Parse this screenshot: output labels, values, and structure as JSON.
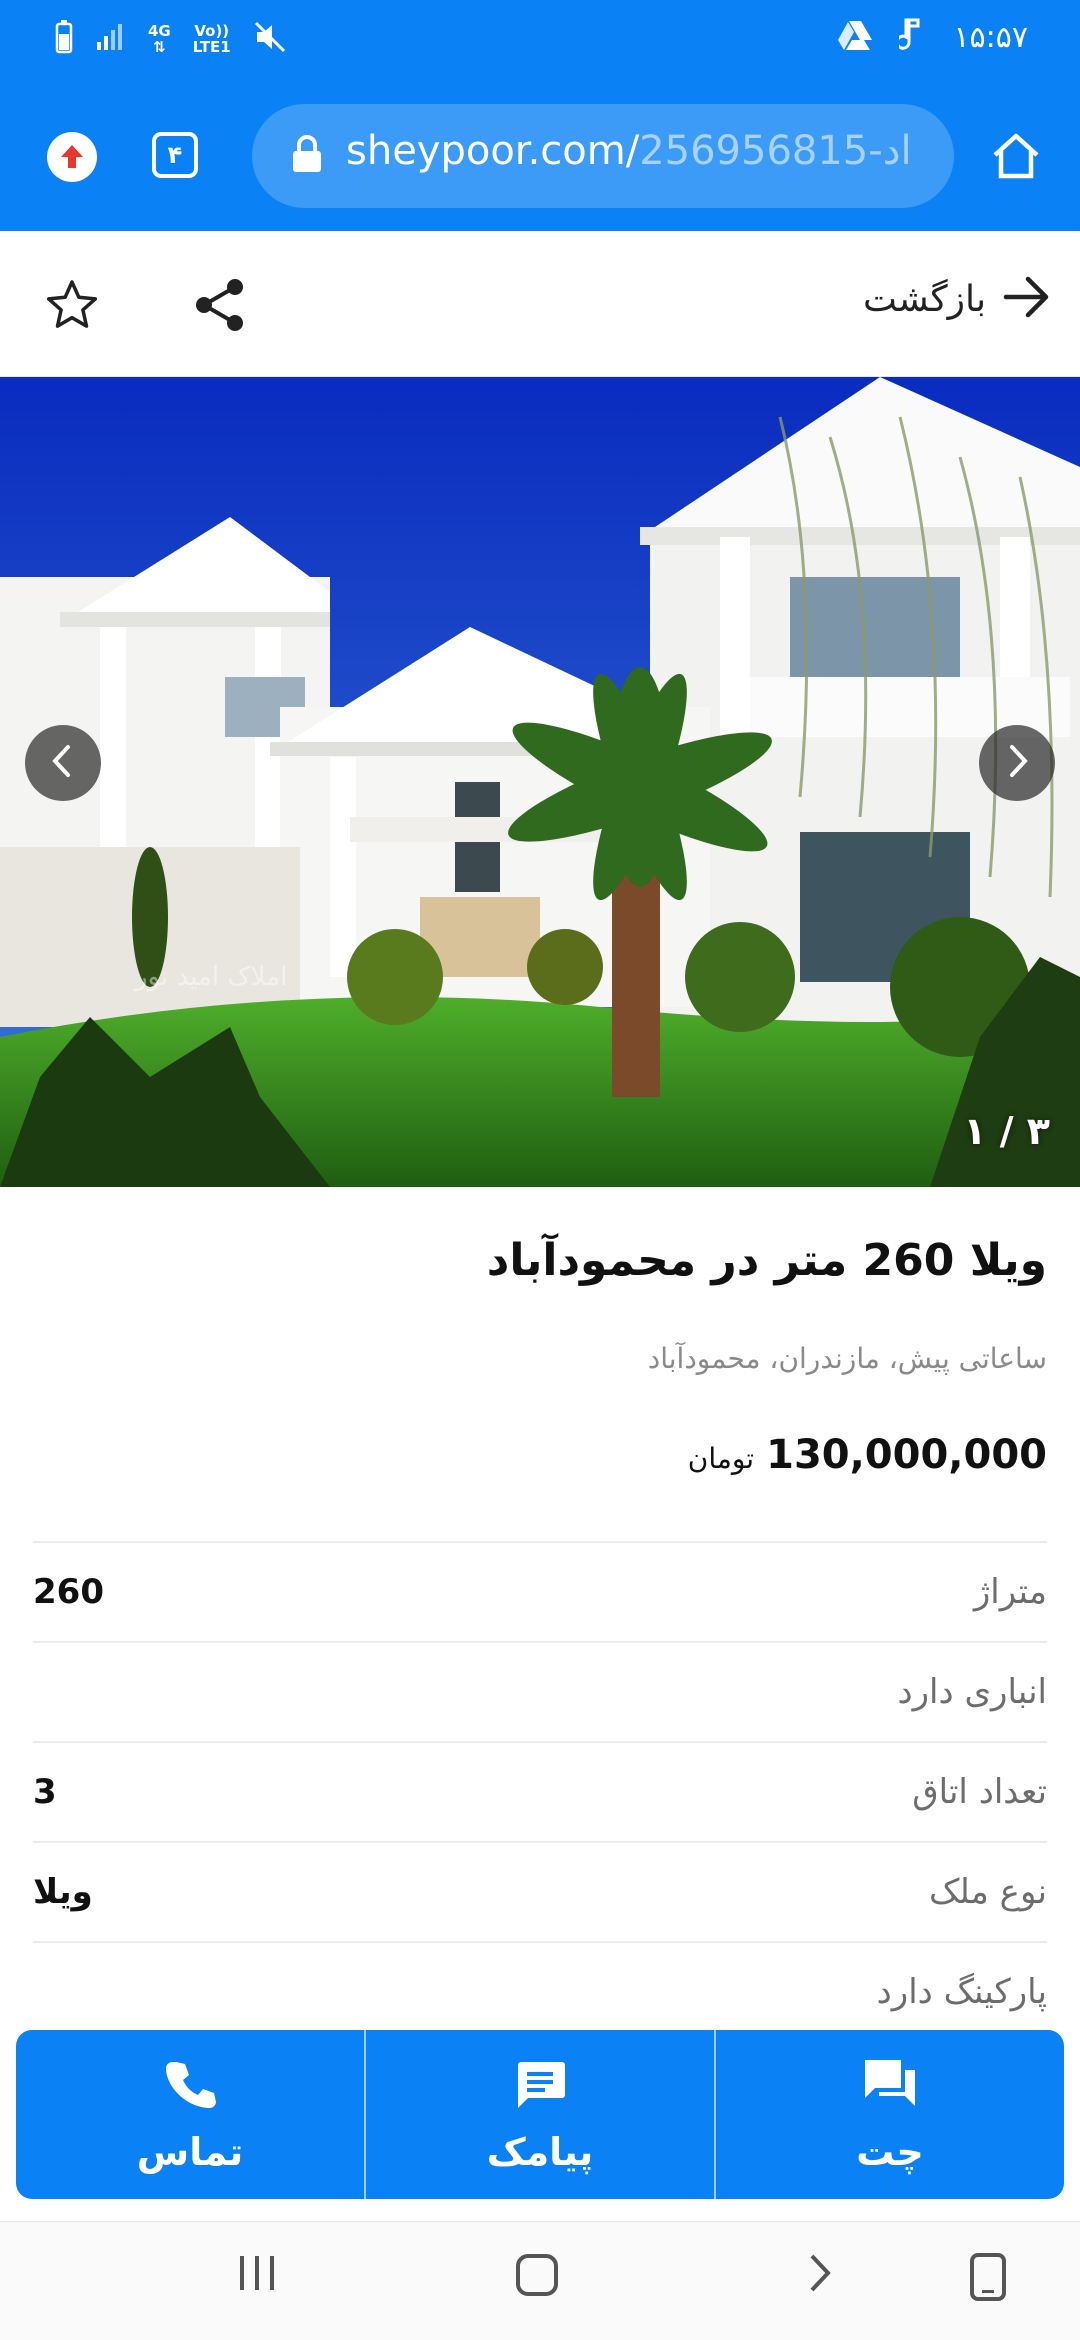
{
  "status_bar": {
    "time": "۱۵:۵۷",
    "network_top": "4G",
    "network_bottom": "LTE1",
    "volte_top": "Vo))",
    "icons": [
      "battery-icon",
      "signal-icon",
      "mute-icon",
      "drive-icon",
      "music-note-icon"
    ]
  },
  "browser": {
    "url_domain": "sheypoor.com/",
    "url_path": "256956815-اد",
    "tab_count": "۴",
    "icons": [
      "upload-icon",
      "tabs-icon",
      "lock-icon",
      "home-icon"
    ]
  },
  "page_header": {
    "back_label": "بازگشت",
    "icons": [
      "back-arrow-icon",
      "share-icon",
      "star-icon"
    ]
  },
  "gallery": {
    "counter": "۱ / ۳",
    "watermark": "املاک امید نور",
    "current_index": 1,
    "total": 3
  },
  "listing": {
    "title": "ویلا 260 متر در محمودآباد",
    "meta": "ساعاتی پیش، مازندران، محمودآباد",
    "price_value": "130,000,000",
    "price_unit": "تومان",
    "attributes": [
      {
        "label": "متراژ",
        "value": "260"
      },
      {
        "label": "انباری دارد",
        "value": ""
      },
      {
        "label": "تعداد اتاق",
        "value": "3"
      },
      {
        "label": "نوع ملک",
        "value": "ویلا"
      },
      {
        "label": "پارکینگ دارد",
        "value": ""
      }
    ]
  },
  "actions": {
    "call_label": "تماس",
    "sms_label": "پیامک",
    "chat_label": "چت"
  },
  "colors": {
    "brand_blue": "#0a82f5",
    "upload_red": "#e8382e"
  }
}
